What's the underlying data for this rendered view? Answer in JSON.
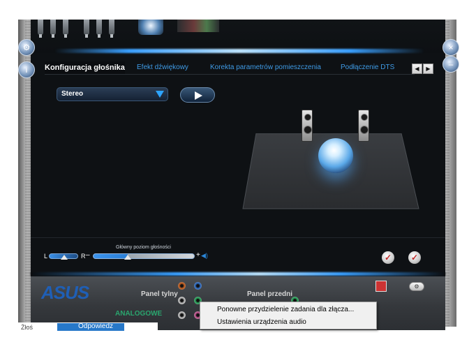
{
  "tabs": [
    {
      "label": "Konfiguracja głośnika",
      "active": true
    },
    {
      "label": "Efekt dźwiękowy",
      "active": false
    },
    {
      "label": "Korekta parametrów pomieszczenia",
      "active": false
    },
    {
      "label": "Podłączenie DTS",
      "active": false
    }
  ],
  "mode_select": {
    "value": "Stereo"
  },
  "volume": {
    "label": "Główny poziom głośności",
    "balance_left": "L",
    "balance_right": "R",
    "level_fraction": 0.34,
    "balance_fraction": 0.5
  },
  "bottom": {
    "brand": "ASUS",
    "rear_panel": "Panel tylny",
    "front_panel": "Panel przedni",
    "analog": "ANALOGOWE"
  },
  "context_menu": {
    "items": [
      "Ponowne przydzielenie zadania dla złącza...",
      "Ustawienia urządzenia audio"
    ]
  },
  "underlay": {
    "left_text": "Żłoś",
    "button": "Odpowiedz"
  },
  "icons": {
    "settings": "gear-icon",
    "info": "info-icon",
    "close": "close-icon",
    "minimize": "minimize-icon"
  },
  "colors": {
    "accent": "#3aa0ff",
    "tab_text": "#3f9be6",
    "analog_text": "#2aa56e"
  }
}
